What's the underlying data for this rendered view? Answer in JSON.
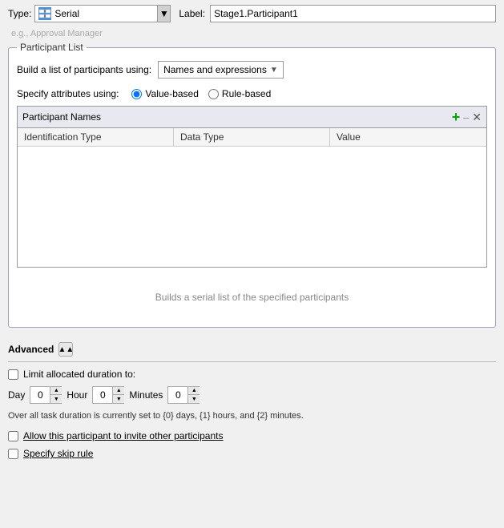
{
  "header": {
    "type_label": "Type:",
    "type_value": "Serial",
    "label_label": "Label:",
    "label_value": "Stage1.Participant1",
    "label_placeholder": "e.g., Approval Manager"
  },
  "participant_list": {
    "group_title": "Participant List",
    "build_label": "Build a list of participants using:",
    "build_dropdown": "Names and expressions",
    "specify_label": "Specify attributes using:",
    "radio_value_based": "Value-based",
    "radio_rule_based": "Rule-based",
    "table_title": "Participant Names",
    "columns": [
      "Identification Type",
      "Data Type",
      "Value"
    ],
    "info_text": "Builds a serial list of the specified participants"
  },
  "advanced": {
    "label": "Advanced",
    "limit_label": "Limit allocated duration to:",
    "day_label": "Day",
    "day_value": "0",
    "hour_label": "Hour",
    "hour_value": "0",
    "minutes_label": "Minutes",
    "minutes_value": "0",
    "duration_text": "Over all task duration is currently set to {0} days, {1} hours, and {2} minutes.",
    "allow_invite_label": "Allow this participant to invite other participants",
    "skip_rule_label": "Specify skip rule"
  }
}
